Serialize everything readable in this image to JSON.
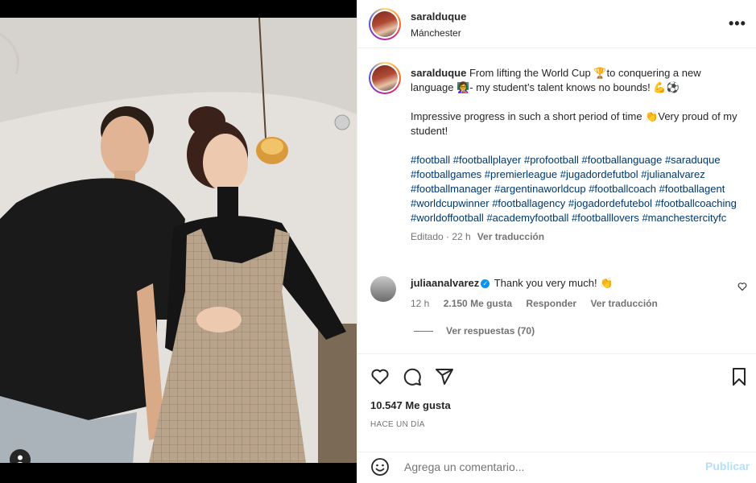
{
  "post": {
    "username": "saralduque",
    "location": "Mánchester",
    "more_label": "•••"
  },
  "caption": {
    "username": "saralduque",
    "line1": "From lifting the World Cup 🏆to conquering a new language 👩‍🏫- my student’s talent knows no bounds! 💪⚽",
    "line2": "Impressive progress in such a short period of time 👏Very proud of my student!",
    "hashtags": [
      "#football",
      "#footballplayer",
      "#profootball",
      "#footballanguage",
      "#saraduque",
      "#footballgames",
      "#premierleague",
      "#jugadordefutbol",
      "#julianalvarez",
      "#footballmanager",
      "#argentinaworldcup",
      "#footballcoach",
      "#footballagent",
      "#worldcupwinner",
      "#footballagency",
      "#jogadordefutebol",
      "#footballcoaching",
      "#worldoffootball",
      "#academyfootball",
      "#footballlovers",
      "#manchestercityfc"
    ],
    "edited": "Editado · 22 h",
    "translate": "Ver traducción"
  },
  "comment": {
    "username": "juliaanalvarez",
    "verified_mark": "✓",
    "text": "Thank you very much! 👏",
    "time": "12 h",
    "likes": "2.150 Me gusta",
    "reply": "Responder",
    "translate": "Ver traducción",
    "view_replies": "Ver respuestas (70)"
  },
  "actions": {
    "likes": "10.547 Me gusta",
    "date": "HACE UN DÍA"
  },
  "add_comment": {
    "placeholder": "Agrega un comentario...",
    "post_label": "Publicar"
  },
  "colors": {
    "link": "#00376b",
    "secondary": "#737373",
    "verified": "#0095f6",
    "post_disabled": "#b2dffc"
  }
}
